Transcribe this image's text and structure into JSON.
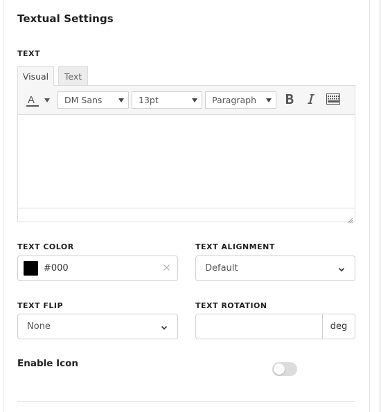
{
  "section": {
    "title": "Textual Settings"
  },
  "text_field": {
    "label": "TEXT",
    "tabs": [
      {
        "label": "Visual",
        "active": true
      },
      {
        "label": "Text",
        "active": false
      }
    ],
    "toolbar": {
      "text_color_icon": "text-color-icon",
      "font_family": "DM Sans",
      "font_size": "13pt",
      "block_format": "Paragraph",
      "bold_icon": "bold-icon",
      "italic_icon": "italic-icon",
      "toolbar_toggle_icon": "keyboard-icon"
    },
    "content": ""
  },
  "text_color": {
    "label": "TEXT COLOR",
    "value": "#000",
    "swatch_color": "#000000"
  },
  "text_alignment": {
    "label": "TEXT ALIGNMENT",
    "selected": "Default"
  },
  "text_flip": {
    "label": "TEXT FLIP",
    "selected": "None"
  },
  "text_rotation": {
    "label": "TEXT ROTATION",
    "value": "",
    "unit": "deg"
  },
  "enable_icon": {
    "label": "Enable Icon",
    "enabled": false
  },
  "colors": {
    "toggle_off": "#dcdcdc",
    "border": "#cfcfcf",
    "toolbar_bg": "#f6f6f6"
  }
}
